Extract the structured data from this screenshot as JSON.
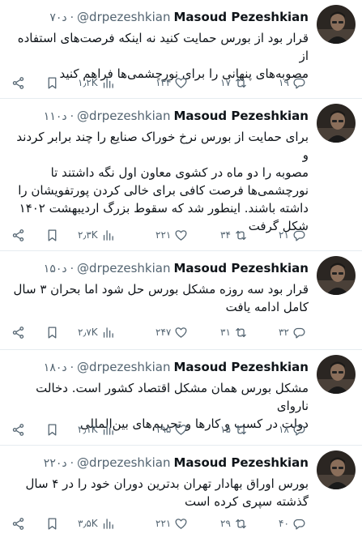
{
  "tweets": [
    {
      "name": "Masoud Pezeshkian",
      "handle": "@drpezeshkian",
      "time": "۷۰د",
      "lines": [
        "قرار بود از بورس حمایت کنید نه اینکه فرصت‌های استفاده از",
        "مصوبه‌های پنهانی را برای نورچشمی‌ها فراهم کنید"
      ],
      "replies": "۱۹",
      "retweets": "۱۷",
      "likes": "۱۳۴",
      "views": "۱٫۲K"
    },
    {
      "name": "Masoud Pezeshkian",
      "handle": "@drpezeshkian",
      "time": "۱۱۰د",
      "lines": [
        "برای حمایت از بورس نرخ خوراک صنایع را چند برابر کردند و",
        "مصوبه را دو ماه در کشوی معاون اول نگه داشتند تا",
        "نورچشمی‌ها فرصت کافی برای خالی کردن پورتفویشان را",
        "داشته باشند. اینطور شد که سقوط بزرگ اردیبهشت ۱۴۰۲",
        "شکل گرفت"
      ],
      "replies": "۲۱",
      "retweets": "۳۴",
      "likes": "۲۲۱",
      "views": "۲٫۳K"
    },
    {
      "name": "Masoud Pezeshkian",
      "handle": "@drpezeshkian",
      "time": "۱۵۰د",
      "lines": [
        "قرار بود سه روزه مشکل بورس حل شود اما بحران ۳ سال",
        "کامل ادامه یافت"
      ],
      "replies": "۳۲",
      "retweets": "۳۱",
      "likes": "۲۴۷",
      "views": "۲٫۷K"
    },
    {
      "name": "Masoud Pezeshkian",
      "handle": "@drpezeshkian",
      "time": "۱۸۰د",
      "lines": [
        "مشکل بورس همان مشکل اقتصاد کشور است. دخالت ناروای",
        "دولت در کسب و کارها و تحریم‌های بین‌المللی"
      ],
      "replies": "۱۸",
      "retweets": "۱۵",
      "likes": "۱۹۵",
      "views": "۲٫۱K"
    },
    {
      "name": "Masoud Pezeshkian",
      "handle": "@drpezeshkian",
      "time": "۲۲۰د",
      "lines": [
        "بورس اوراق بهادار تهران بدترین دوران خود را در ۴ سال",
        "گذشته سپری کرده است"
      ],
      "replies": "۴۰",
      "retweets": "۲۹",
      "likes": "۲۲۱",
      "views": "۳٫۵K"
    }
  ]
}
